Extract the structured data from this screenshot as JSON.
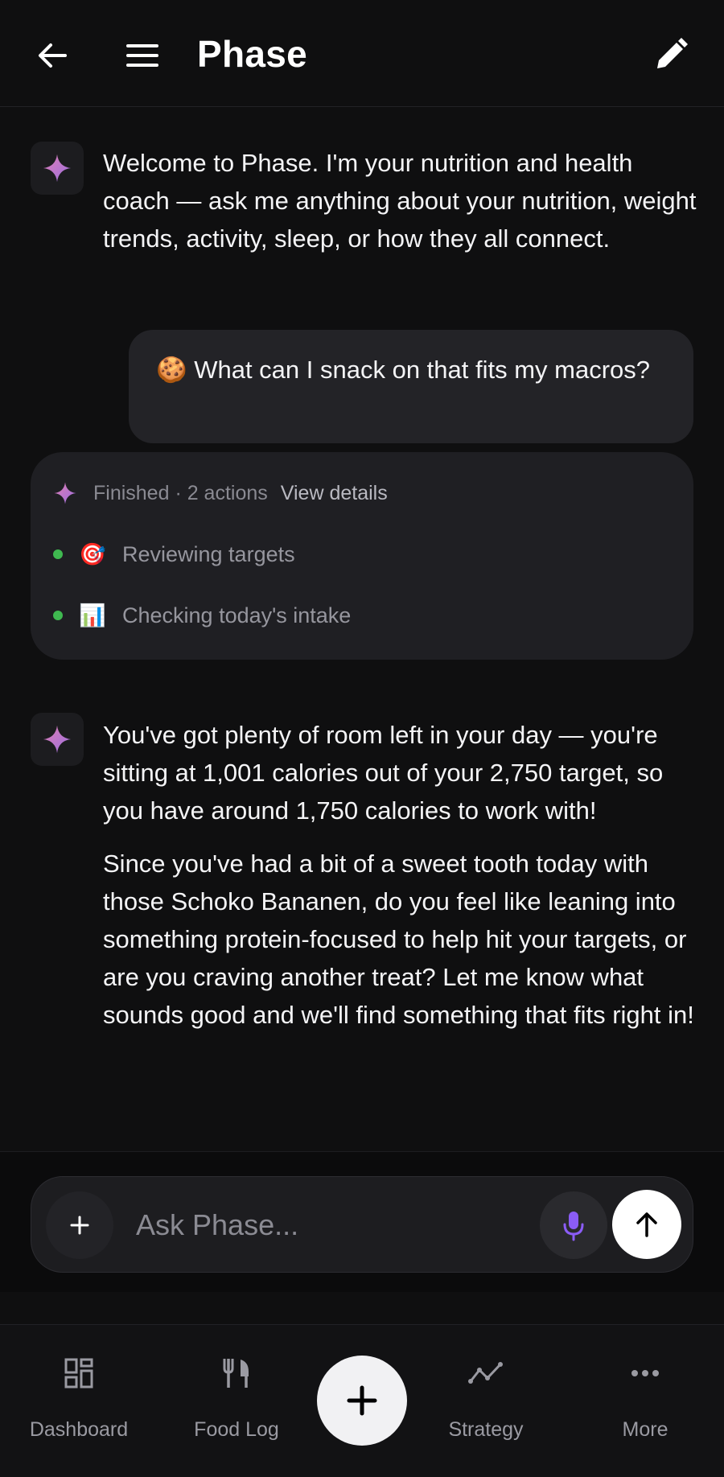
{
  "header": {
    "title": "Phase"
  },
  "messages": {
    "welcome": "Welcome to Phase. I'm your nutrition and health coach — ask me anything about your nutrition, weight trends, activity, sleep, or how they all connect.",
    "user_question": "🍪 What can I snack on that fits my macros?",
    "actions": {
      "status": "Finished · 2 actions",
      "view_details": "View details",
      "items": [
        {
          "emoji": "🎯",
          "label": "Reviewing targets"
        },
        {
          "emoji": "📊",
          "label": "Checking today's intake"
        }
      ]
    },
    "reply_p1": "You've got plenty of room left in your day — you're sitting at 1,001 calories out of your 2,750 target, so you have around 1,750 calories to work with!",
    "reply_p2": "Since you've had a bit of a sweet tooth today with those Schoko Bananen, do you feel like leaning into something protein-focused to help hit your targets, or are you craving another treat? Let me know what sounds good and we'll find something that fits right in!"
  },
  "composer": {
    "placeholder": "Ask Phase..."
  },
  "bottom_nav": {
    "items": [
      {
        "label": "Dashboard",
        "icon": "dashboard-icon"
      },
      {
        "label": "Food Log",
        "icon": "utensils-icon"
      },
      {
        "label": "Strategy",
        "icon": "trend-icon"
      },
      {
        "label": "More",
        "icon": "more-icon"
      }
    ]
  },
  "colors": {
    "background": "#0f0f10",
    "accent_sparkle": "#c86fc9",
    "status_dot": "#3fb950",
    "mic": "#8b5cf6"
  }
}
